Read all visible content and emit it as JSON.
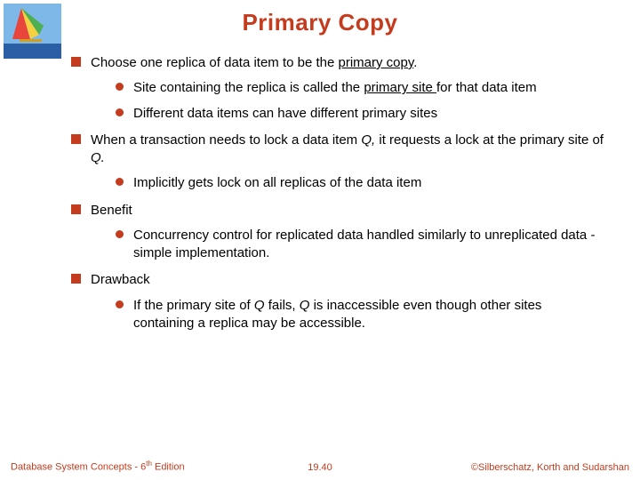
{
  "title": "Primary Copy",
  "bullets": {
    "b1": "Choose one replica of data item to be the ",
    "b1u": "primary copy",
    "b1end": ".",
    "b1a_pre": "Site containing the replica is called  the ",
    "b1a_u": "primary site ",
    "b1a_post": "for that data item",
    "b1b": "Different data items can have different primary sites",
    "b2_pre": "When a transaction needs to lock a data item ",
    "b2_q1": "Q, ",
    "b2_mid": "it requests a lock at the primary site of ",
    "b2_q2": "Q.",
    "b2a": "Implicitly gets lock on all replicas of the data item",
    "b3": "Benefit",
    "b3a": "Concurrency control for replicated data handled similarly to unreplicated data - simple implementation.",
    "b4": "Drawback",
    "b4a_pre": "If the primary site of  ",
    "b4a_q1": "Q ",
    "b4a_mid": "fails, ",
    "b4a_q2": "Q ",
    "b4a_post": "is inaccessible even though other sites containing a replica may be accessible."
  },
  "footer": {
    "left_pre": "Database System Concepts - 6",
    "left_sup": "th",
    "left_post": " Edition",
    "center": "19.40",
    "right": "©Silberschatz, Korth and Sudarshan"
  }
}
